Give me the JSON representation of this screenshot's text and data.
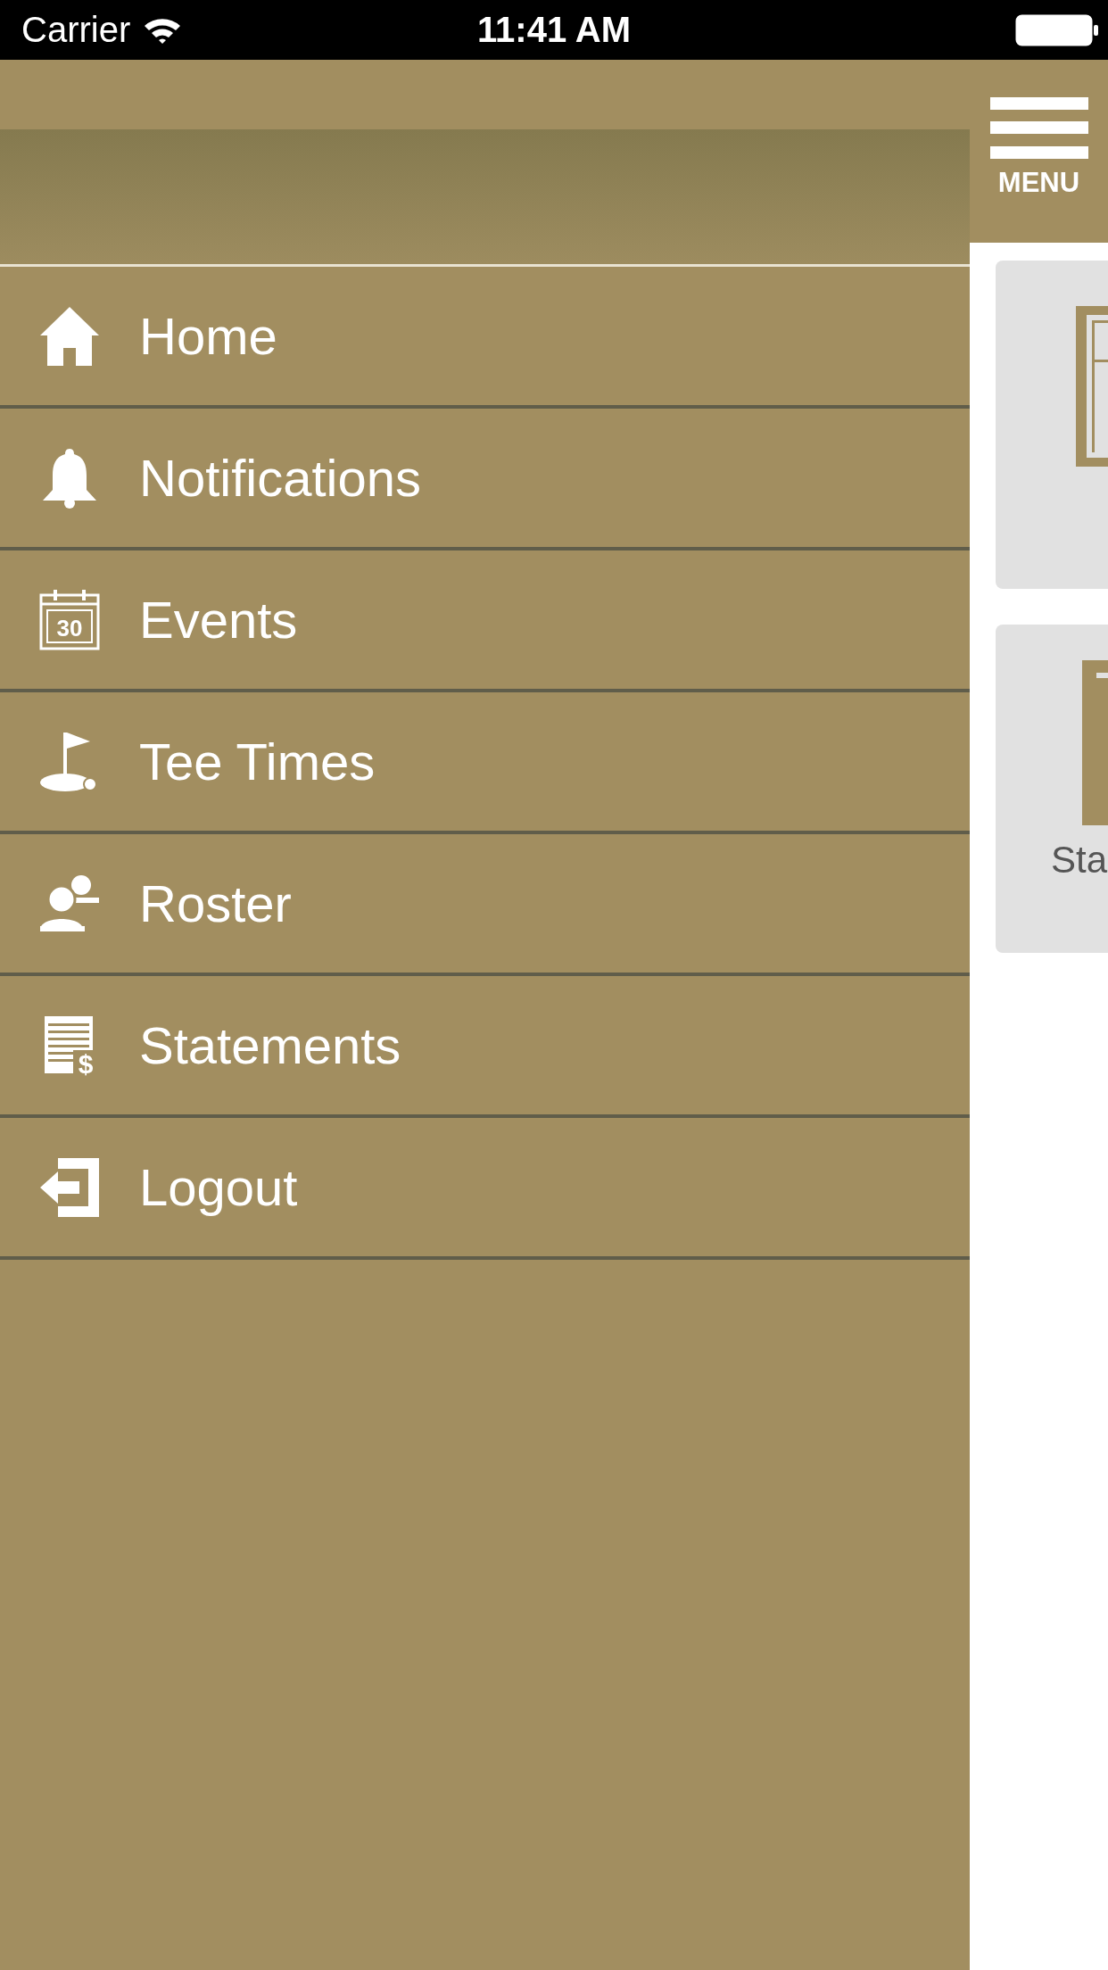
{
  "status_bar": {
    "carrier": "Carrier",
    "time": "11:41 AM"
  },
  "menu_button": {
    "label": "MENU"
  },
  "drawer": {
    "items": [
      {
        "kind": "home",
        "label": "Home"
      },
      {
        "kind": "bell",
        "label": "Notifications"
      },
      {
        "kind": "calendar",
        "label": "Events",
        "icon_text": "30"
      },
      {
        "kind": "flag",
        "label": "Tee Times"
      },
      {
        "kind": "people",
        "label": "Roster"
      },
      {
        "kind": "statement",
        "label": "Statements",
        "icon_text": "$"
      },
      {
        "kind": "logout",
        "label": "Logout"
      }
    ]
  },
  "tiles": [
    {
      "kind": "frame"
    },
    {
      "kind": "tall",
      "label": "Sta"
    }
  ]
}
